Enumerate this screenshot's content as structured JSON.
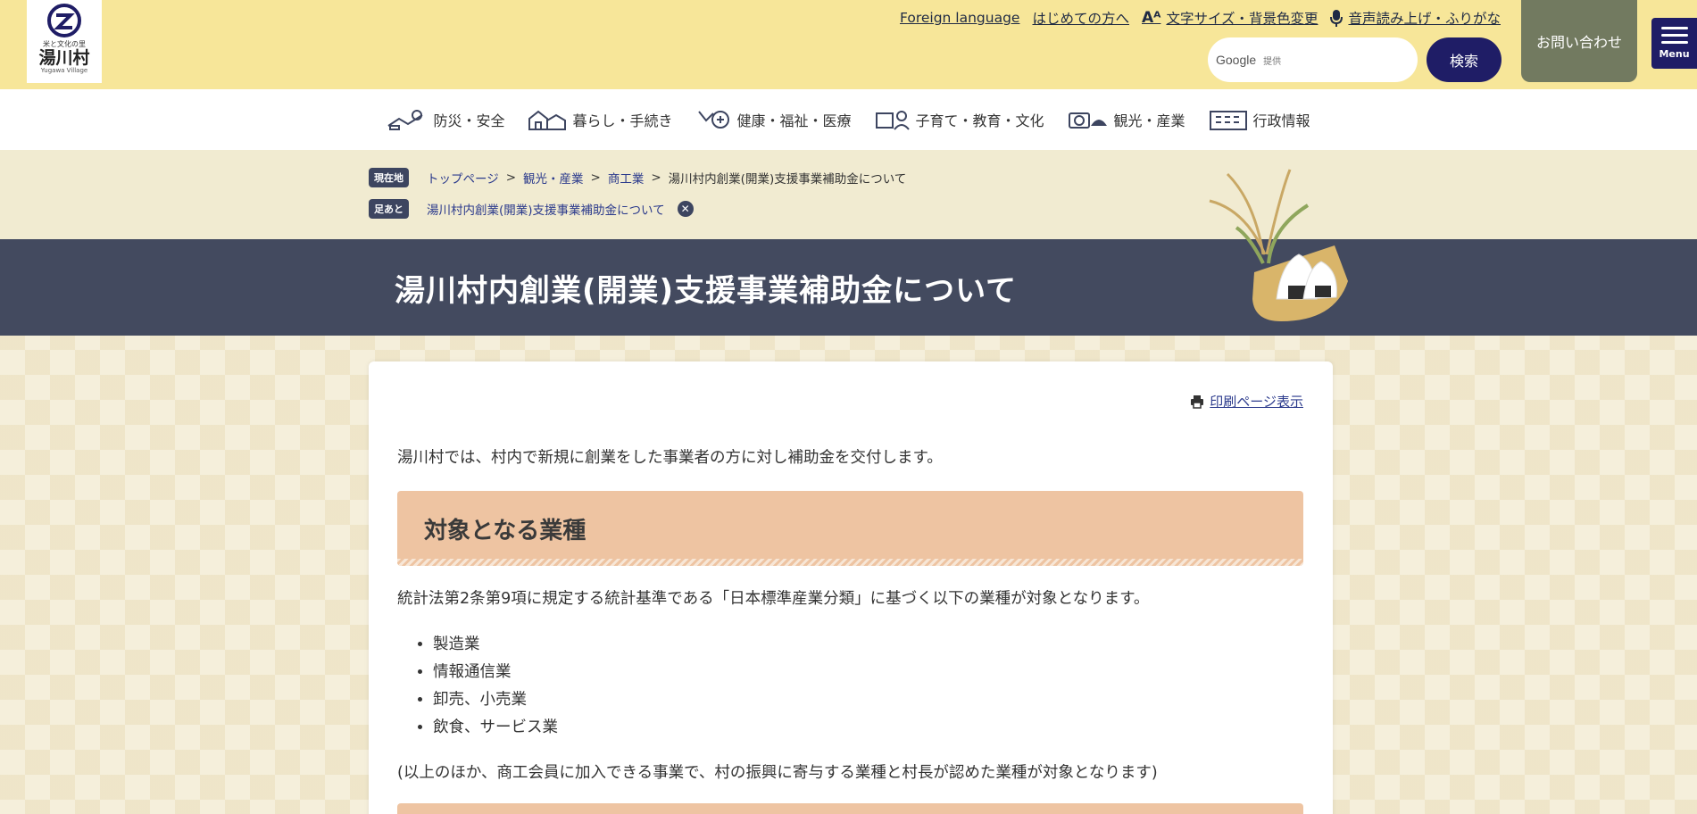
{
  "header": {
    "logo": {
      "tagline": "米と文化の里",
      "name": "湯川村",
      "name_en": "Yugawa Village"
    },
    "utility_links": [
      {
        "label": "Foreign language"
      },
      {
        "label": "はじめての方へ"
      },
      {
        "label": "文字サイズ・背景色変更",
        "icon": "text-size-icon"
      },
      {
        "label": "音声読み上げ・ふりがな",
        "icon": "microphone-icon"
      }
    ],
    "search": {
      "brand": "Google",
      "brand_sub": "提供",
      "placeholder": "",
      "button_label": "検索"
    },
    "contact_label": "お問い合わせ",
    "menu_label": "Menu"
  },
  "global_nav": [
    {
      "label": "防災・安全",
      "icon": "disaster-safety-icon"
    },
    {
      "label": "暮らし・手続き",
      "icon": "living-icon"
    },
    {
      "label": "健康・福祉・医療",
      "icon": "health-icon"
    },
    {
      "label": "子育て・教育・文化",
      "icon": "education-icon"
    },
    {
      "label": "観光・産業",
      "icon": "tourism-icon"
    },
    {
      "label": "行政情報",
      "icon": "government-icon"
    }
  ],
  "breadcrumb": {
    "current_tag": "現在地",
    "items": [
      "トップページ",
      "観光・産業",
      "商工業"
    ],
    "current": "湯川村内創業(開業)支援事業補助金について",
    "history_tag": "足あと",
    "history_items": [
      "湯川村内創業(開業)支援事業補助金について"
    ]
  },
  "page": {
    "title": "湯川村内創業(開業)支援事業補助金について",
    "print_label": "印刷ページ表示",
    "intro": "湯川村では、村内で新規に創業をした事業者の方に対し補助金を交付します。",
    "section": {
      "heading": "対象となる業種",
      "description": "統計法第2条第9項に規定する統計基準である「日本標準産業分類」に基づく以下の業種が対象となります。",
      "industries": [
        "製造業",
        "情報通信業",
        "卸売、小売業",
        "飲食、サービス業"
      ],
      "note": "(以上のほか、商工会員に加入できる事業で、村の振興に寄与する業種と村長が認めた業種が対象となります)"
    }
  },
  "colors": {
    "header_bg": "#f7e699",
    "navy": "#1f1d66",
    "title_band": "#434a5f",
    "contact_bg": "#727a60",
    "heading_bg": "#eec4a2"
  }
}
